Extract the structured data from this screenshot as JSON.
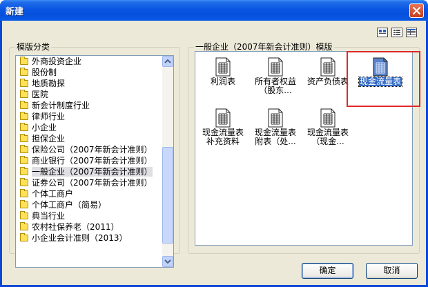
{
  "window": {
    "title": "新建"
  },
  "left_group": {
    "label": "模版分类",
    "items": [
      {
        "label": "外商投资企业"
      },
      {
        "label": "股份制"
      },
      {
        "label": "地质勘探"
      },
      {
        "label": "医院"
      },
      {
        "label": "新会计制度行业"
      },
      {
        "label": "律师行业"
      },
      {
        "label": "小企业"
      },
      {
        "label": "担保企业"
      },
      {
        "label": "保险公司（2007年新会计准则）"
      },
      {
        "label": "商业银行（2007年新会计准则）"
      },
      {
        "label": "一般企业（2007年新会计准则）",
        "selected": true
      },
      {
        "label": "证券公司（2007年新会计准则）"
      },
      {
        "label": "个体工商户"
      },
      {
        "label": "个体工商户（简易）"
      },
      {
        "label": "典当行业"
      },
      {
        "label": "农村社保养老（2011）"
      },
      {
        "label": "小企业会计准则（2013）"
      }
    ]
  },
  "right_group": {
    "label": "一般企业（2007年新会计准则）模版",
    "templates": [
      {
        "label": "利润表"
      },
      {
        "label": "所有者权益\n（股东..."
      },
      {
        "label": "资产负债表"
      },
      {
        "label": "现金流量表",
        "selected": true
      },
      {
        "label": "现金流量表\n补充资料"
      },
      {
        "label": "现金流量表\n附表（处..."
      },
      {
        "label": "现金流量表\n（现金..."
      }
    ]
  },
  "view_icons": [
    "large-icons-view-icon",
    "small-icons-view-icon",
    "details-view-icon"
  ],
  "buttons": {
    "ok": "确定",
    "cancel": "取消"
  },
  "colors": {
    "titlebar": "#0a56e2",
    "dialog_bg": "#ece9d8",
    "selection": "#316ac5",
    "highlight_box": "#e02828"
  }
}
